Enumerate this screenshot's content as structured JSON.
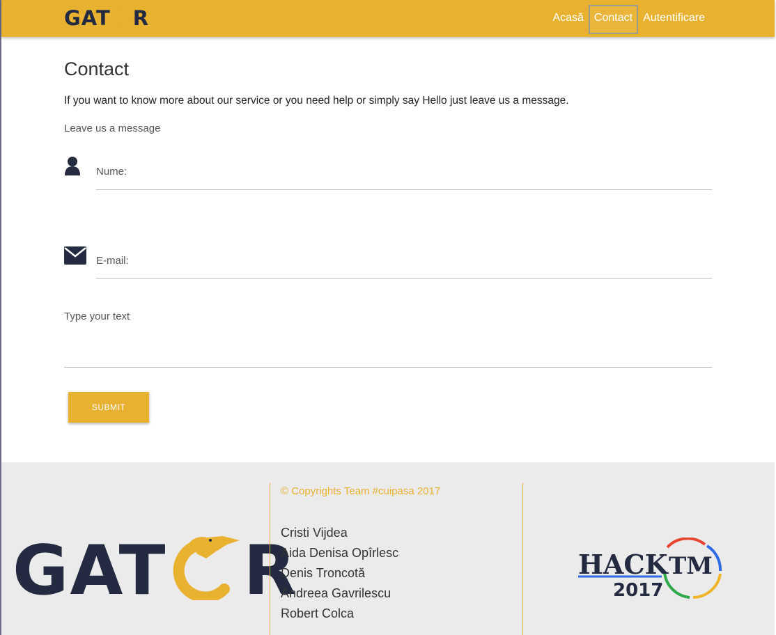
{
  "navbar": {
    "logo_alt": "GATOR",
    "links": [
      {
        "label": "Acasă"
      },
      {
        "label": "Contact"
      },
      {
        "label": "Autentificare"
      }
    ],
    "active_index": 1,
    "bg_color": "#e8b130"
  },
  "main": {
    "title": "Contact",
    "intro": "If you want to know more about our service or you need help or simply say Hello just leave us a message.",
    "subtitle": "Leave us a message",
    "fields": {
      "name": {
        "label": "Nume:",
        "icon": "user-icon"
      },
      "email": {
        "label": "E-mail:",
        "icon": "envelope-icon"
      },
      "text": {
        "label": "Type your text"
      }
    },
    "submit_label": "SUBMIT"
  },
  "footer": {
    "copyright": "© Copyrights Team #cuipasa 2017",
    "team": [
      "Cristi Vijdea",
      "Aida Denisa Opîrlesc",
      "Denis Troncotă",
      "Andreea Gavrilescu",
      "Robert Colca"
    ],
    "hack_logo": {
      "word": "HACK",
      "tm": "TM",
      "year": "2017"
    }
  }
}
